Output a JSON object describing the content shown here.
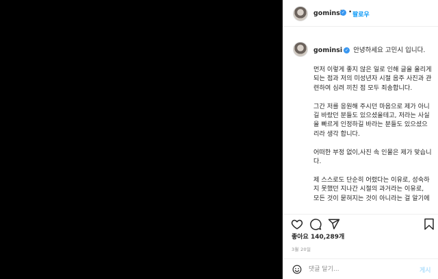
{
  "header": {
    "username": "gominsi",
    "separator": "•",
    "follow_label": "팔로우"
  },
  "caption": {
    "username": "gominsi",
    "intro": "안녕하세요 고민시 입니다.",
    "paragraphs": [
      "먼저 이렇게 좋지 않은 일로 인해 글을 올리게 되는 점과 저의 미성년자 시절 음주 사진과 관련하여 심려 끼친 점 모두 죄송합니다.",
      "그간 저를 응원해 주시던 마음으로 제가 아니길 바랐던 분들도 있으셨을테고, 저라는 사실을 빠르게 인정하길 바라는 분들도 있으셨으리라 생각 합니다.",
      "어떠한 부정 없이,사진 속 인물은 제가 맞습니다.",
      "제 스스로도 단순히 어렸다는 이유로, 성숙하지 못했던 지나간 시절의 과거라는 이유로,\n모든 것이 묻혀지는 것이 아니라는 걸 알기에"
    ]
  },
  "stats": {
    "likes": "좋아요 140,289개",
    "date": "3월 20일"
  },
  "comment": {
    "placeholder": "댓글 달기...",
    "post_label": "게시"
  },
  "colors": {
    "accent": "#0095f6",
    "verified": "#3897f0",
    "post_disabled": "#b2dffc"
  }
}
